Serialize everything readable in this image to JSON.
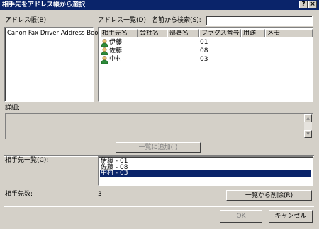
{
  "window": {
    "title": "相手先をアドレス帳から選択",
    "help_label": "?",
    "close_label": "×"
  },
  "address_book": {
    "label": "アドレス帳(B)",
    "items": [
      "Canon Fax Driver Address Book"
    ]
  },
  "address_list": {
    "label": "アドレス一覧(D):",
    "search_label": "名前から検索(S):",
    "search_value": "",
    "columns": [
      "相手先名",
      "会社名",
      "部署名",
      "ファクス番号",
      "用途",
      "メモ"
    ],
    "rows": [
      {
        "name": "伊藤",
        "company": "",
        "department": "",
        "fax": "01",
        "usage": "",
        "memo": ""
      },
      {
        "name": "佐藤",
        "company": "",
        "department": "",
        "fax": "08",
        "usage": "",
        "memo": ""
      },
      {
        "name": "中村",
        "company": "",
        "department": "",
        "fax": "03",
        "usage": "",
        "memo": ""
      }
    ]
  },
  "details": {
    "label": "詳細:",
    "value": ""
  },
  "add_button": {
    "label": "一覧に追加(I)"
  },
  "recipients": {
    "label": "相手先一覧(C):",
    "items": [
      "伊藤 - 01",
      "佐藤 - 08",
      "中村 - 03"
    ],
    "selected_index": 2
  },
  "count": {
    "label": "相手先数:",
    "value": "3"
  },
  "remove_button": {
    "label": "一覧から削除(R)"
  },
  "ok_button": {
    "label": "OK"
  },
  "cancel_button": {
    "label": "キャンセル"
  },
  "colors": {
    "titlebar": "#0a246a",
    "face": "#d4d0c8",
    "selection": "#0a246a"
  }
}
